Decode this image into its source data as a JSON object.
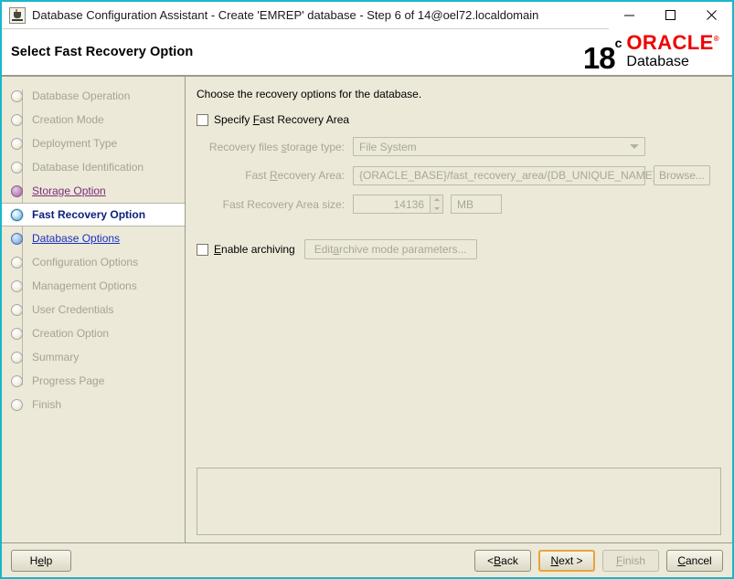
{
  "window": {
    "title": "Database Configuration Assistant - Create 'EMREP' database - Step 6 of 14@oel72.localdomain",
    "icon": "java-duke-icon",
    "minimize_label": "–",
    "maximize_label": "□",
    "close_label": "✕"
  },
  "banner": {
    "title": "Select Fast Recovery Option",
    "logo_version": "18",
    "logo_superscript": "c",
    "logo_brand": "ORACLE",
    "logo_reg": "®",
    "logo_product": "Database",
    "brand_color": "#f00000"
  },
  "sidebar": {
    "items": [
      {
        "label": "Database Operation",
        "state": "done"
      },
      {
        "label": "Creation Mode",
        "state": "done"
      },
      {
        "label": "Deployment Type",
        "state": "done"
      },
      {
        "label": "Database Identification",
        "state": "done"
      },
      {
        "label": "Storage Option",
        "state": "visited"
      },
      {
        "label": "Fast Recovery Option",
        "state": "current"
      },
      {
        "label": "Database Options",
        "state": "next"
      },
      {
        "label": "Configuration Options",
        "state": "done"
      },
      {
        "label": "Management Options",
        "state": "done"
      },
      {
        "label": "User Credentials",
        "state": "done"
      },
      {
        "label": "Creation Option",
        "state": "done"
      },
      {
        "label": "Summary",
        "state": "done"
      },
      {
        "label": "Progress Page",
        "state": "done"
      },
      {
        "label": "Finish",
        "state": "done"
      }
    ]
  },
  "main": {
    "intro": "Choose the recovery options for the database.",
    "specify_fra": {
      "label_pre": "Specify ",
      "label_mnemonic": "F",
      "label_post": "ast Recovery Area",
      "checked": false
    },
    "storage_type": {
      "label_pre": "Recovery files ",
      "label_mnemonic": "s",
      "label_post": "torage type:",
      "value": "File System",
      "enabled": false
    },
    "fra_path": {
      "label_pre": "Fast ",
      "label_mnemonic": "R",
      "label_post": "ecovery Area:",
      "value": "{ORACLE_BASE}/fast_recovery_area/{DB_UNIQUE_NAME}",
      "enabled": false,
      "browse_label": "Browse..."
    },
    "fra_size": {
      "label": "Fast Recovery Area size:",
      "value": "14136",
      "unit": "MB",
      "enabled": false
    },
    "enable_archiving": {
      "label_pre": "",
      "label_mnemonic": "E",
      "label_post": "nable archiving",
      "checked": false,
      "edit_button_pre": "Edit ",
      "edit_button_mnemonic": "a",
      "edit_button_post": "rchive mode parameters..."
    },
    "message_panel": ""
  },
  "footer": {
    "help": {
      "pre": "H",
      "mnemonic": "e",
      "post": "lp"
    },
    "back": {
      "pre": "< ",
      "mnemonic": "B",
      "post": "ack"
    },
    "next": {
      "pre": "",
      "mnemonic": "N",
      "post": "ext >"
    },
    "finish": {
      "pre": "",
      "mnemonic": "F",
      "post": "inish"
    },
    "cancel": {
      "pre": "",
      "mnemonic": "C",
      "post": "ancel"
    }
  }
}
